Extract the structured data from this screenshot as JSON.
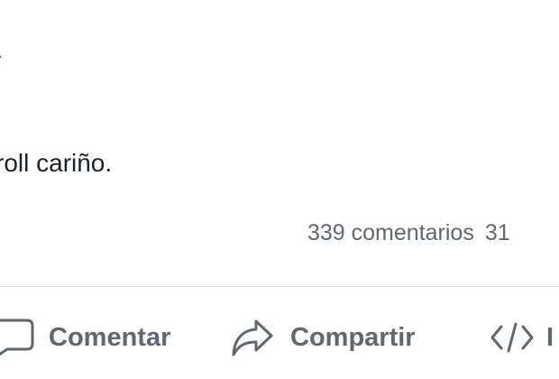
{
  "post": {
    "author_fragment": "a",
    "text": "roll cariño."
  },
  "stats": {
    "comments": "339 comentarios",
    "shares_fragment": "31"
  },
  "actions": {
    "comment": {
      "label": "Comentar",
      "icon": "comment-icon"
    },
    "share": {
      "label": "Compartir",
      "icon": "share-icon"
    },
    "embed": {
      "label": "I",
      "icon": "code-icon"
    }
  }
}
